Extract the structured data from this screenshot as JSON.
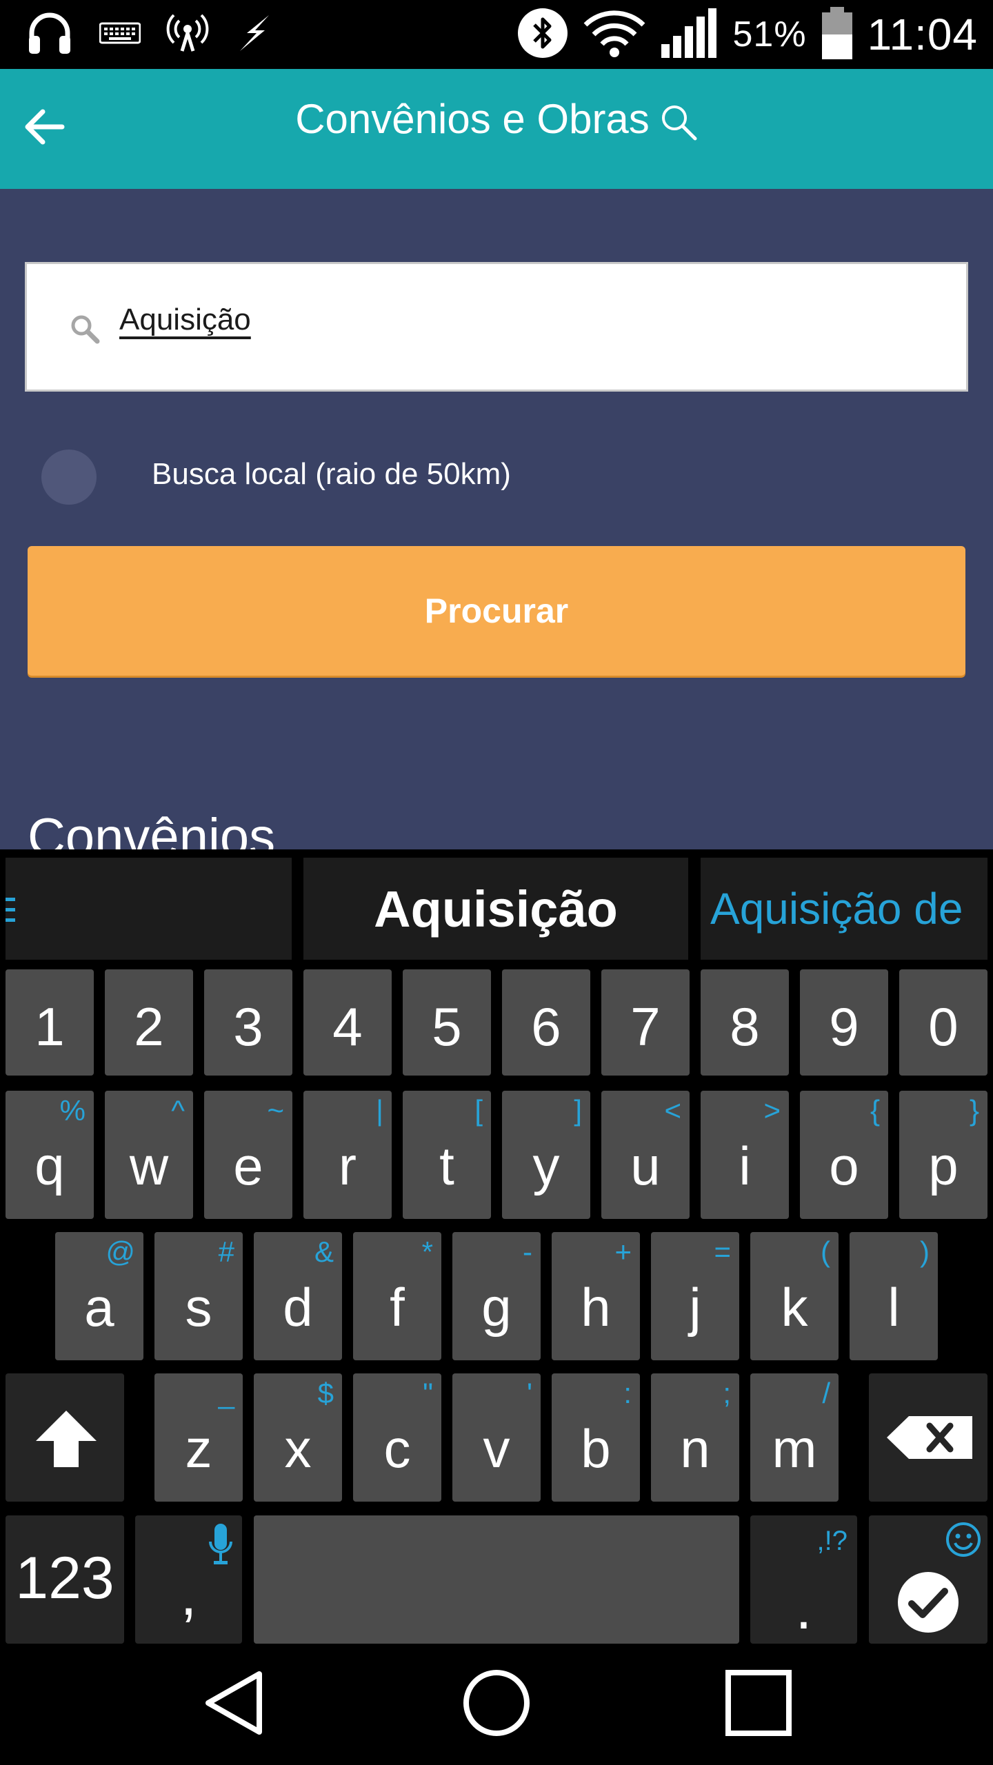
{
  "status_bar": {
    "icons_left": [
      "headphones-icon",
      "keyboard-icon",
      "hotspot-icon",
      "flash-icon"
    ],
    "icons_right": [
      "bluetooth-icon",
      "wifi-icon",
      "signal-icon"
    ],
    "battery_percent": "51%",
    "battery_level": 0.51,
    "time": "11:04"
  },
  "app_bar": {
    "title": "Convênios e Obras",
    "back_icon": "arrow-left-icon",
    "title_icon": "search-icon"
  },
  "search": {
    "value": "Aquisição",
    "icon": "search-icon"
  },
  "local_search": {
    "label": "Busca local (raio de 50km)",
    "checked": false
  },
  "search_button": {
    "label": "Procurar"
  },
  "section": {
    "title": "Convênios"
  },
  "keyboard": {
    "suggestions": [
      "",
      "Aquisição",
      "Aquisição de"
    ],
    "accent_color": "#27a3d8",
    "number_row": [
      "1",
      "2",
      "3",
      "4",
      "5",
      "6",
      "7",
      "8",
      "9",
      "0"
    ],
    "row1": [
      {
        "key": "q",
        "hint": "%"
      },
      {
        "key": "w",
        "hint": "^"
      },
      {
        "key": "e",
        "hint": "~"
      },
      {
        "key": "r",
        "hint": "|"
      },
      {
        "key": "t",
        "hint": "["
      },
      {
        "key": "y",
        "hint": "]"
      },
      {
        "key": "u",
        "hint": "<"
      },
      {
        "key": "i",
        "hint": ">"
      },
      {
        "key": "o",
        "hint": "{"
      },
      {
        "key": "p",
        "hint": "}"
      }
    ],
    "row2": [
      {
        "key": "a",
        "hint": "@"
      },
      {
        "key": "s",
        "hint": "#"
      },
      {
        "key": "d",
        "hint": "&"
      },
      {
        "key": "f",
        "hint": "*"
      },
      {
        "key": "g",
        "hint": "-"
      },
      {
        "key": "h",
        "hint": "+"
      },
      {
        "key": "j",
        "hint": "="
      },
      {
        "key": "k",
        "hint": "("
      },
      {
        "key": "l",
        "hint": ")"
      }
    ],
    "row3": [
      {
        "key": "z",
        "hint": "_"
      },
      {
        "key": "x",
        "hint": "$"
      },
      {
        "key": "c",
        "hint": "\""
      },
      {
        "key": "v",
        "hint": "'"
      },
      {
        "key": "b",
        "hint": ":"
      },
      {
        "key": "n",
        "hint": ";"
      },
      {
        "key": "m",
        "hint": "/"
      }
    ],
    "shift_icon": "shift-arrow-icon",
    "backspace_icon": "backspace-icon",
    "mode_key": "123",
    "comma_key": ",",
    "mic_icon": "microphone-icon",
    "period_key": ".",
    "period_hint": ",!?",
    "emoji_icon": "smiley-icon",
    "enter_icon": "checkmark-icon"
  },
  "nav_bar": {
    "back": "triangle-back-icon",
    "home": "circle-home-icon",
    "recents": "square-recents-icon"
  },
  "colors": {
    "app_bar": "#17a8ad",
    "background": "#3a4265",
    "button": "#f8ac4f"
  }
}
